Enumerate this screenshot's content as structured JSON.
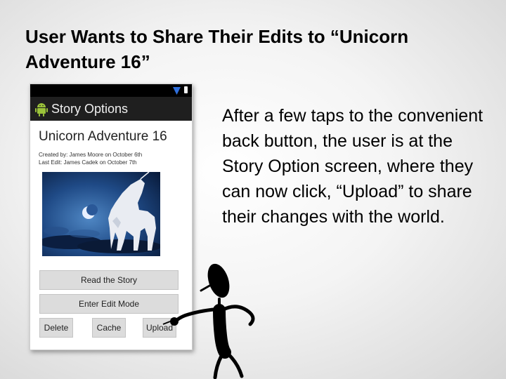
{
  "slide": {
    "title": "User Wants to Share Their Edits to “Unicorn Adventure 16”",
    "body": "After a few taps to the convenient back button, the user is at the Story Option screen, where they can now click, “Upload” to share their changes with the world."
  },
  "phone": {
    "action_bar_title": "Story Options",
    "story_title": "Unicorn Adventure 16",
    "created_by": "Created by: James Moore on October 6th",
    "last_edit": "Last Edit: James Cadek on October 7th",
    "image_icon": "unicorn-image",
    "buttons": {
      "read": "Read the Story",
      "edit": "Enter Edit Mode",
      "delete": "Delete",
      "cache": "Cache",
      "upload": "Upload"
    }
  },
  "colors": {
    "action_bar": "#1f1f1f",
    "status_bar": "#000000",
    "wifi": "#2f6fdc",
    "android": "#9bc33a",
    "button": "#dcdcdc"
  }
}
